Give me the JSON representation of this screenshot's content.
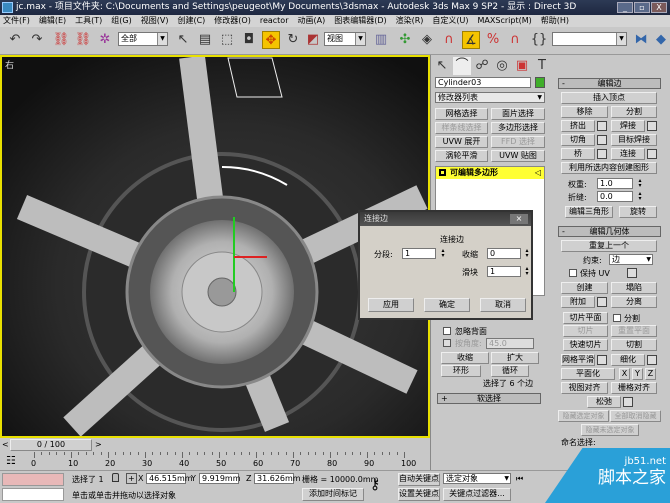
{
  "title": {
    "text": "jc.max  - 项目文件夹: C:\\Documents and Settings\\peugeot\\My Documents\\3dsmax  - Autodesk 3ds Max 9 SP2  - 显示 : Direct 3D",
    "minimize": "_",
    "maximize": "▫",
    "close": "X"
  },
  "menu": [
    "文件(F)",
    "编辑(E)",
    "工具(T)",
    "组(G)",
    "视图(V)",
    "创建(C)",
    "修改器(O)",
    "reactor",
    "动画(A)",
    "图表编辑器(D)",
    "渲染(R)",
    "自定义(U)",
    "MAXScript(M)",
    "帮助(H)"
  ],
  "toolbar": {
    "selection_filter": "全部",
    "ref_coord": "视图",
    "named_selection": ""
  },
  "viewport": {
    "label": "右"
  },
  "command_panel": {
    "object_name": "Cylinder03",
    "object_color": "#3fae2a",
    "modifier_list": "修改器列表",
    "mod_buttons": [
      "网格选择",
      "面片选择",
      "样条线选择",
      "多边形选择",
      "UVW 展开",
      "FFD 选择",
      "涡轮平滑",
      "UVW 贴图"
    ],
    "stack_item": "可编辑多边形",
    "selection": {
      "ignore_backfacing": "忽略背面",
      "by_angle": "按角度:",
      "angle": "45.0",
      "shrink": "收缩",
      "grow": "扩大",
      "ring": "环形",
      "loop": "循环",
      "status": "选择了 6 个边",
      "soft_selection": "软选择"
    },
    "edit_edges": {
      "title": "编辑边",
      "insert_vertex": "插入顶点",
      "remove": "移除",
      "split": "分割",
      "extrude": "挤出",
      "weld": "焊接",
      "chamfer": "切角",
      "target_weld": "目标焊接",
      "bridge": "桥",
      "connect": "连接",
      "create_shape": "利用所选内容创建图形",
      "weight_label": "权重:",
      "weight": "1.0",
      "crease_label": "折缝:",
      "crease": "0.0",
      "edit_tri": "编辑三角形",
      "turn": "旋转"
    },
    "edit_geometry": {
      "title": "编辑几何体",
      "repeat_last": "重复上一个",
      "constraints_label": "约束:",
      "constraints": "边",
      "preserve_uv": "保持 UV",
      "create": "创建",
      "collapse": "塌陷",
      "attach": "附加",
      "detach": "分离",
      "slice_plane": "切片平面",
      "split": "分割",
      "slice": "切片",
      "reset_plane": "重置平面",
      "quickslice": "快速切片",
      "cut": "切割",
      "meshsmooth": "网格平滑",
      "tessellate": "细化",
      "make_planar": "平面化",
      "x": "X",
      "y": "Y",
      "z": "Z",
      "view_align": "视图对齐",
      "grid_align": "栅格对齐",
      "relax": "松弛",
      "hide_selected": "隐藏选定对象",
      "unhide_all": "全部取消隐藏",
      "hide_unselected": "隐藏未选定对象",
      "named_selections": "命名选择:"
    }
  },
  "dialog": {
    "title": "连接边",
    "group": "连接边",
    "segments_label": "分段:",
    "segments": "1",
    "pinch_label": "收缩",
    "pinch": "0",
    "slide_label": "滑块",
    "slide": "1",
    "apply": "应用",
    "ok": "确定",
    "cancel": "取消"
  },
  "timeline": {
    "frame": "0 / 100",
    "ticks": [
      "0",
      "10",
      "20",
      "30",
      "40",
      "50",
      "60",
      "70",
      "80",
      "90",
      "100"
    ]
  },
  "status": {
    "selected": "选择了 1",
    "x_label": "X",
    "x": "46.515mm",
    "y_label": "Y",
    "y": "9.919mm",
    "z_label": "Z",
    "z": "31.626mm",
    "grid": "栅格 = 10000.0mm",
    "prompt": "单击或单击并拖动以选择对象",
    "add_time_tag": "添加时间标记",
    "auto_key": "自动关键点",
    "set_key": "设置关键点",
    "key_mode": "选定对象",
    "key_filters": "关键点过滤器..."
  },
  "watermark": {
    "site": "jb51.net",
    "name": "脚本之家"
  }
}
